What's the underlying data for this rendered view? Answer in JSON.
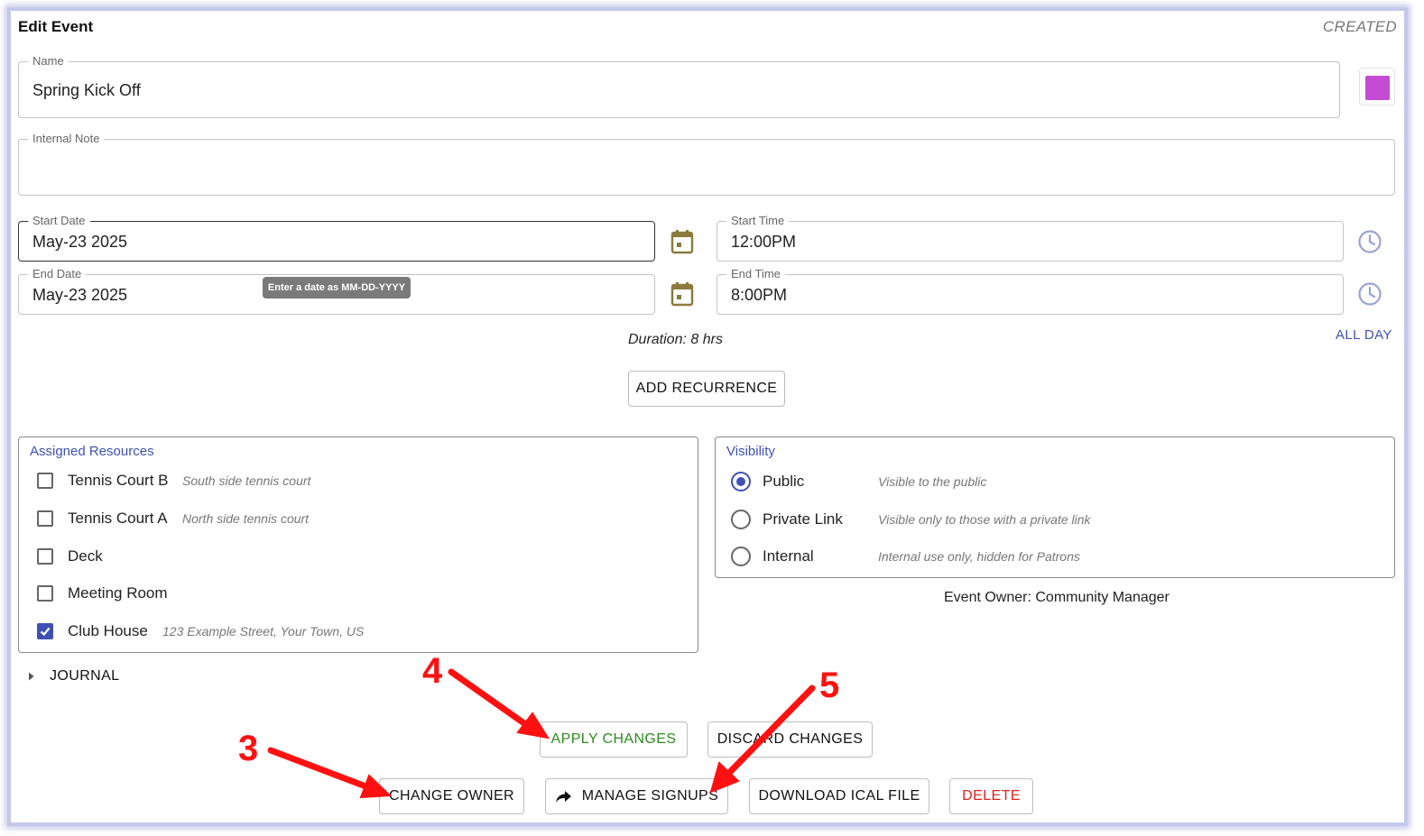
{
  "header": {
    "title": "Edit Event",
    "status": "CREATED"
  },
  "form": {
    "name": {
      "label": "Name",
      "value": "Spring Kick Off"
    },
    "color": "#c44bd3",
    "internal_note": {
      "label": "Internal Note",
      "value": ""
    },
    "start_date": {
      "label": "Start Date",
      "value": "May-23 2025"
    },
    "end_date": {
      "label": "End Date",
      "value": "May-23 2025"
    },
    "date_tooltip": "Enter a date as MM-DD-YYYY",
    "start_time": {
      "label": "Start Time",
      "value": "12:00PM"
    },
    "end_time": {
      "label": "End Time",
      "value": "8:00PM"
    },
    "duration": "Duration: 8 hrs",
    "all_day_label": "ALL DAY",
    "add_recurrence_label": "ADD RECURRENCE"
  },
  "resources": {
    "title": "Assigned Resources",
    "items": [
      {
        "name": "Tennis Court B",
        "description": "South side tennis court",
        "checked": false
      },
      {
        "name": "Tennis Court A",
        "description": "North side tennis court",
        "checked": false
      },
      {
        "name": "Deck",
        "description": "",
        "checked": false
      },
      {
        "name": "Meeting Room",
        "description": "",
        "checked": false
      },
      {
        "name": "Club House",
        "description": "123 Example Street, Your Town, US",
        "checked": true
      }
    ]
  },
  "visibility": {
    "title": "Visibility",
    "options": [
      {
        "name": "Public",
        "description": "Visible to the public",
        "selected": true
      },
      {
        "name": "Private Link",
        "description": "Visible only to those with a private link",
        "selected": false
      },
      {
        "name": "Internal",
        "description": "Internal use only, hidden for Patrons",
        "selected": false
      }
    ]
  },
  "owner_text": "Event Owner: Community Manager",
  "journal_label": "JOURNAL",
  "actions": {
    "apply": "APPLY CHANGES",
    "discard": "DISCARD CHANGES",
    "change_owner": "CHANGE OWNER",
    "manage_signups": "MANAGE SIGNUPS",
    "download_ical": "DOWNLOAD ICAL FILE",
    "delete": "DELETE"
  },
  "annotations": {
    "three": "3",
    "four": "4",
    "five": "5"
  },
  "colors": {
    "accent": "#3f51b5",
    "apply": "#2e8b1f",
    "delete": "#e0201b",
    "annotation": "#ff1111",
    "calendar_icon": "#8a7a3d",
    "clock_icon": "#9aa3d4"
  },
  "icons": [
    "calendar-icon",
    "clock-icon",
    "share-arrow-icon",
    "caret-right-icon",
    "check-icon"
  ]
}
